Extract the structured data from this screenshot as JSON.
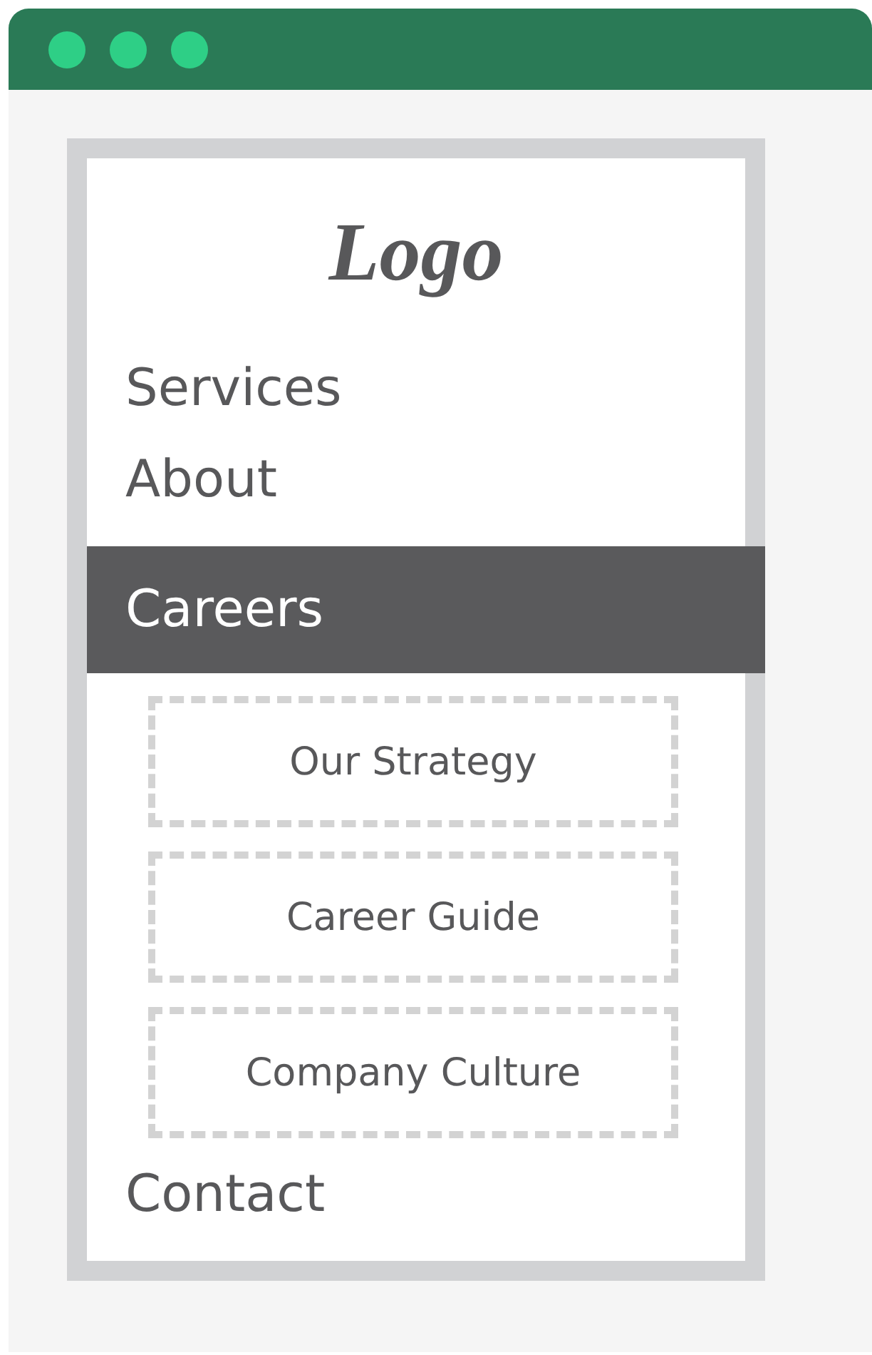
{
  "logo": "Logo",
  "menu": [
    {
      "label": "Services",
      "selected": false
    },
    {
      "label": "About",
      "selected": false
    },
    {
      "label": "Careers",
      "selected": true,
      "children": [
        {
          "label": "Our Strategy"
        },
        {
          "label": "Career Guide"
        },
        {
          "label": "Company Culture"
        }
      ]
    },
    {
      "label": "Contact",
      "selected": false
    }
  ]
}
